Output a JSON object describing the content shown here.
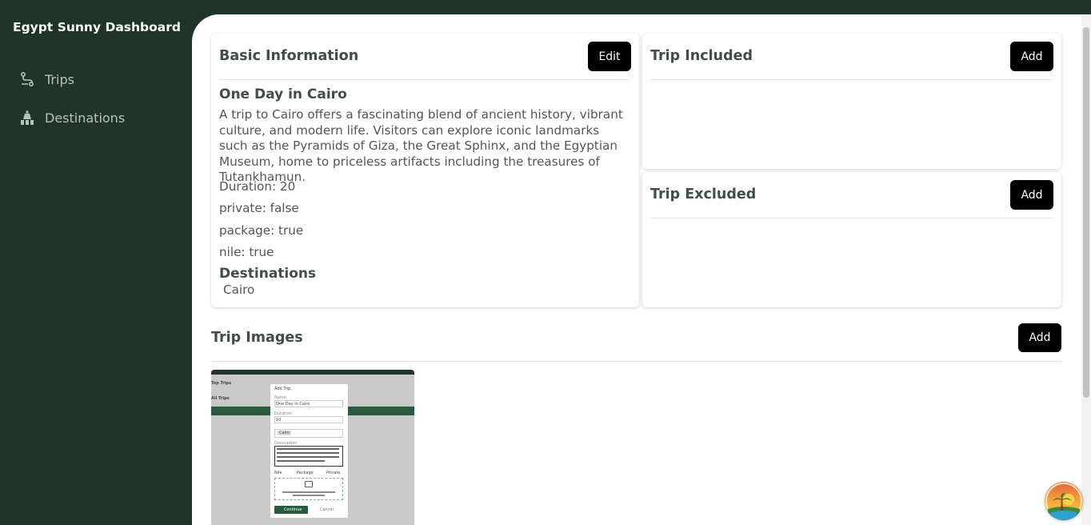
{
  "brand": "Egypt Sunny Dashboard",
  "nav": [
    {
      "label": "Trips",
      "icon": "route-icon"
    },
    {
      "label": "Destinations",
      "icon": "landmark-icon"
    }
  ],
  "basic_info": {
    "title": "Basic Information",
    "edit_label": "Edit",
    "trip_name": "One Day in Cairo",
    "description": "A trip to Cairo offers a fascinating blend of ancient history, vibrant culture, and modern life. Visitors can explore iconic landmarks such as the Pyramids of Giza, the Great Sphinx, and the Egyptian Museum, home to priceless artifacts including the treasures of Tutankhamun.",
    "duration": "Duration: 20",
    "private": "private: false",
    "package": "package: true",
    "nile": "nile: true",
    "destinations_title": "Destinations",
    "destinations": [
      "Cairo"
    ]
  },
  "trip_included": {
    "title": "Trip Included",
    "add_label": "Add"
  },
  "trip_excluded": {
    "title": "Trip Excluded",
    "add_label": "Add"
  },
  "trip_images": {
    "title": "Trip Images",
    "add_label": "Add",
    "thumbnail": {
      "sidebar_top": "Top Trips",
      "sidebar_all": "All Trips",
      "modal_title": "Add Trip",
      "name_label": "Name",
      "name_value": "One Day in Cairo",
      "duration_label": "Duration",
      "duration_value": "10",
      "chip": "Cairo",
      "desc_label": "Description",
      "check_nile": "Nile",
      "check_package": "Package",
      "check_private": "Private",
      "continue": "Continue",
      "cancel": "Cancel"
    }
  },
  "colors": {
    "sidebar": "#1f3529",
    "button": "#000000",
    "accent": "#2d5a3d"
  }
}
